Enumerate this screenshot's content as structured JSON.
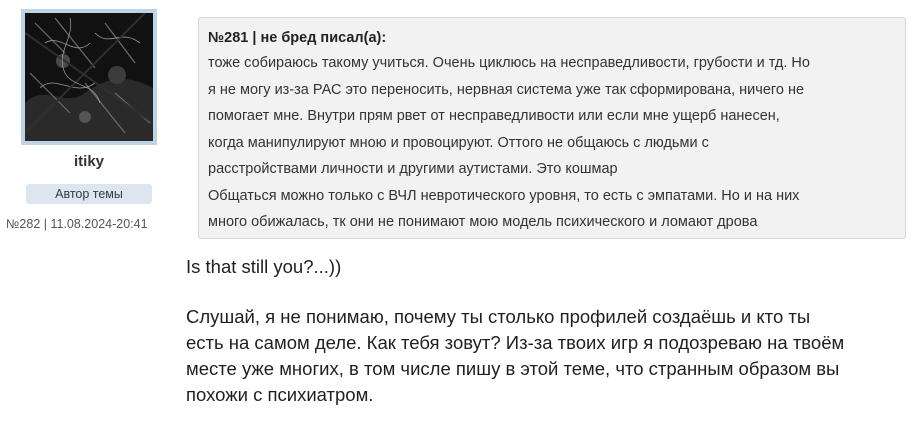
{
  "author": {
    "username": "itiky",
    "role_badge": "Автор темы",
    "post_number": "№282",
    "separator": "|",
    "post_datetime": "11.08.2024-20:41"
  },
  "quote": {
    "header": "№281 | не бред писал(а):",
    "lines": [
      "тоже собираюсь такому учиться. Очень циклюсь на несправедливости, грубости и тд. Но",
      "я не могу из-за РАС это переносить, нервная система уже так сформирована, ничего не",
      "помогает мне. Внутри прям рвет от несправедливости или если мне ущерб нанесен,",
      "когда манипулируют мною и провоцируют. Оттого не общаюсь с людьми с",
      "расстройствами личности и другими аутистами. Это кошмар",
      "Общаться можно только с ВЧЛ невротического уровня, то есть с эмпатами. Но и на них",
      "много обижалась, тк они не понимают мою модель психического и ломают дрова"
    ]
  },
  "message": {
    "first_line": "Is that still you?...))",
    "body_lines": [
      "Слушай, я не понимаю, почему ты столько профилей создаёшь и кто ты",
      "есть на самом деле. Как тебя зовут? Из-за твоих игр я подозреваю на твоём",
      "месте уже многих, в том числе пишу в этой теме, что странным образом вы",
      "похожи с психиатром."
    ]
  },
  "colors": {
    "avatar_border": "#bfd3e6",
    "badge_bg": "#dde6ef",
    "quote_bg": "#f2f2f2",
    "quote_border": "#d6d6d6"
  },
  "icons": {
    "avatar": "user-avatar-image"
  }
}
